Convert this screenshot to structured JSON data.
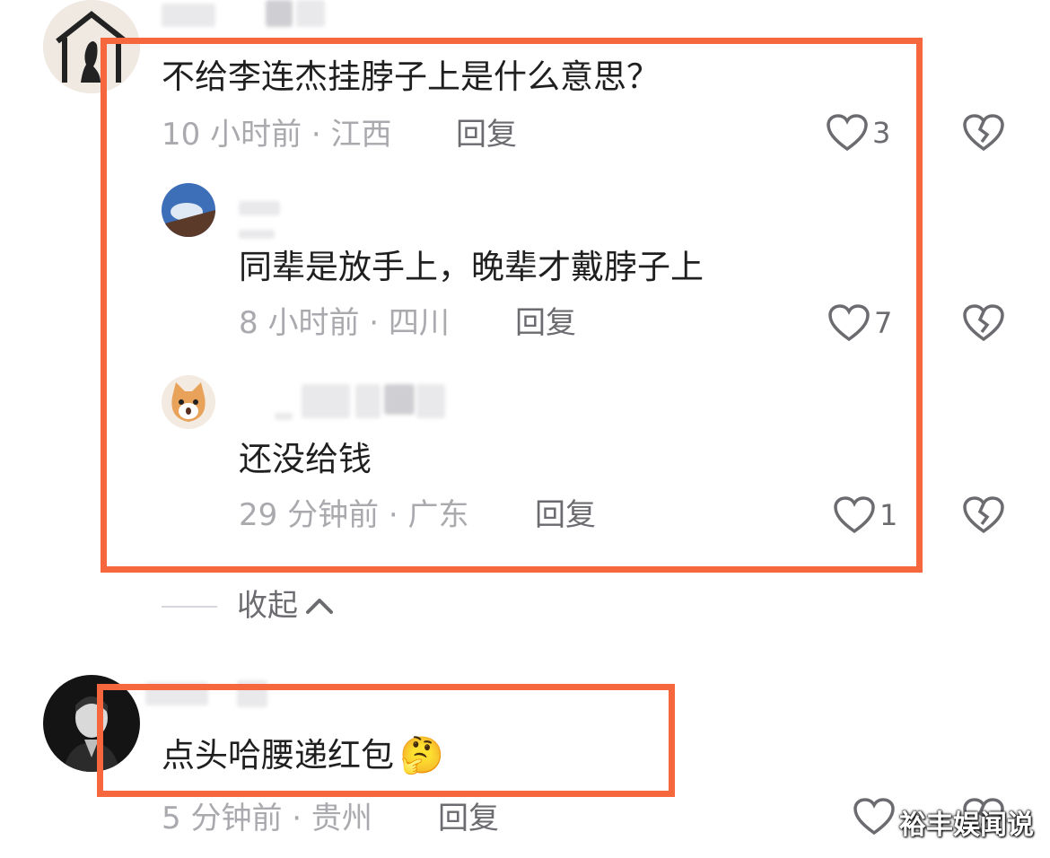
{
  "comments": [
    {
      "text": "不给李连杰挂脖子上是什么意思？",
      "meta": "10 小时前 · 江西",
      "reply_label": "回复",
      "likes": "3"
    }
  ],
  "replies": [
    {
      "text": "同辈是放手上，晚辈才戴脖子上",
      "meta": "8 小时前 · 四川",
      "reply_label": "回复",
      "likes": "7"
    },
    {
      "text": "还没给钱",
      "meta": "29 分钟前 · 广东",
      "reply_label": "回复",
      "likes": "1"
    }
  ],
  "collapse_label": "收起",
  "second_comment": {
    "text": "点头哈腰递红包",
    "emoji": "🤔",
    "meta": "5 分钟前 · 贵州",
    "reply_label": "回复"
  },
  "watermark": "裕丰娱闻说",
  "colors": {
    "highlight": "#f7673e",
    "meta_text": "#a9a9ae",
    "reply_text": "#6b6b70"
  },
  "icons": {
    "like": "heart-outline-icon",
    "dislike": "broken-heart-icon",
    "collapse": "chevron-up-icon"
  }
}
